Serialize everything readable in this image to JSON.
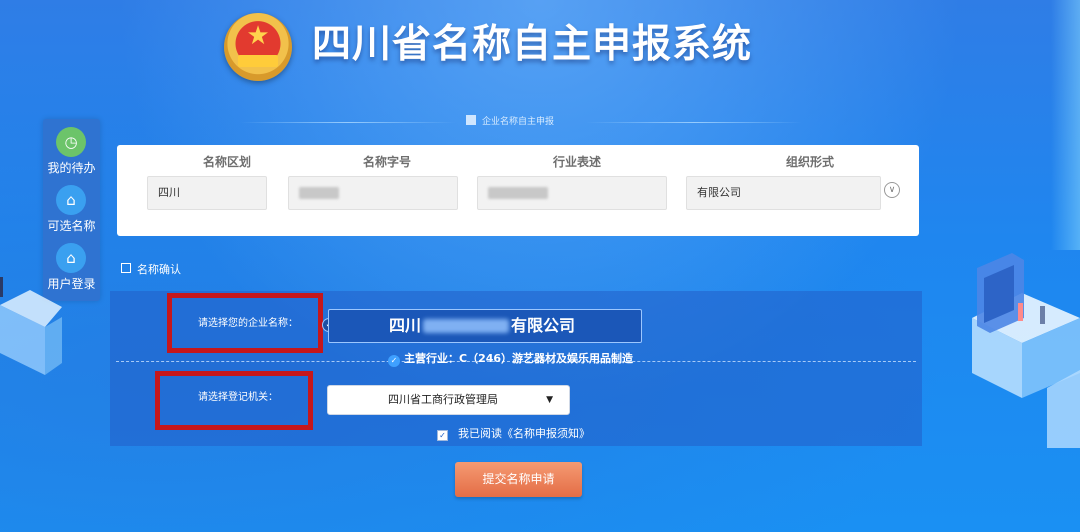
{
  "header": {
    "title": "四川省名称自主申报系统",
    "emblem_icon": "national-emblem-icon"
  },
  "sidenav": {
    "items": [
      {
        "label": "我的待办",
        "icon": "clock-icon",
        "color": "#6cc46a"
      },
      {
        "label": "可选名称",
        "icon": "home-icon",
        "color": "#3aa0f0"
      },
      {
        "label": "用户登录",
        "icon": "home-icon",
        "color": "#3aa0f0"
      }
    ]
  },
  "section": {
    "title": "企业名称自主申报",
    "icon": "building-icon"
  },
  "name_fields": {
    "columns": [
      "名称区划",
      "名称字号",
      "行业表述",
      "组织形式"
    ],
    "values": [
      "四川",
      "",
      "",
      "有限公司"
    ],
    "expand_icon": "chevron-down-circle-icon"
  },
  "confirm": {
    "heading": "名称确认",
    "company_label": "请选择您的企业名称：",
    "company_name_prefix": "四川",
    "company_name_suffix": "有限公司",
    "industry_text": "主营行业：C（246）游艺器材及娱乐用品制造",
    "authority_label": "请选择登记机关：",
    "authority_value": "四川省工商行政管理局",
    "agree_text": "我已阅读《名称申报须知》",
    "agree_checked": true,
    "submit_label": "提交名称申请"
  },
  "colors": {
    "highlight_red": "#c5171c",
    "submit_orange": "#e46d46",
    "bg_blue": "#1f86ef"
  }
}
